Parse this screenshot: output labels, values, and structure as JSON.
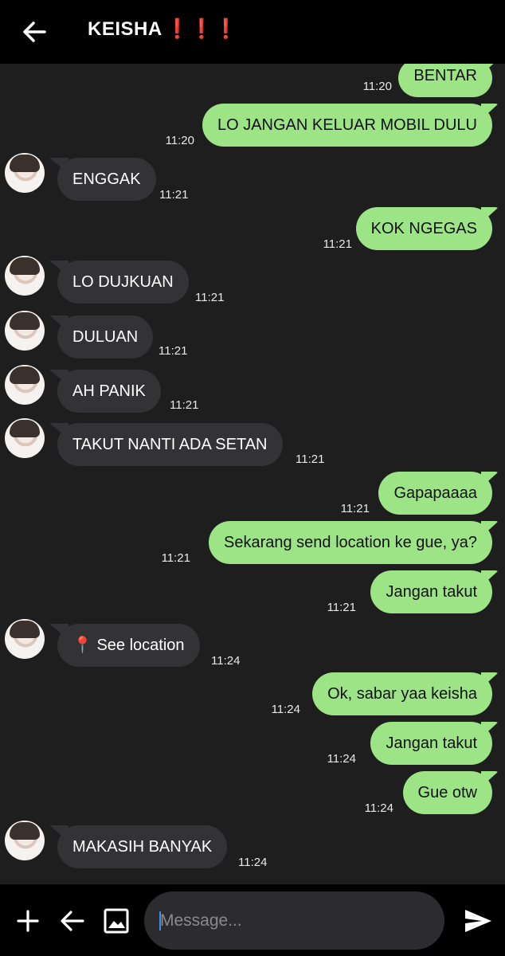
{
  "header": {
    "title": "KEISHA",
    "title_suffix": "❗❗❗",
    "back_icon": "arrow-left-icon"
  },
  "messages": [
    {
      "dir": "sent",
      "text": "BENTAR",
      "time": "11:20"
    },
    {
      "dir": "sent",
      "text": "LO JANGAN KELUAR MOBIL DULU",
      "time": "11:20"
    },
    {
      "dir": "recv",
      "text": "ENGGAK",
      "time": "11:21"
    },
    {
      "dir": "sent",
      "text": "KOK NGEGAS",
      "time": "11:21"
    },
    {
      "dir": "recv",
      "text": "LO DUJKUAN",
      "time": "11:21"
    },
    {
      "dir": "recv",
      "text": "DULUAN",
      "time": "11:21"
    },
    {
      "dir": "recv",
      "text": "AH PANIK",
      "time": "11:21"
    },
    {
      "dir": "recv",
      "text": "TAKUT NANTI ADA SETAN",
      "time": "11:21"
    },
    {
      "dir": "sent",
      "text": "Gapapaaaa",
      "time": "11:21"
    },
    {
      "dir": "sent",
      "text": "Sekarang send location ke gue, ya?",
      "time": "11:21"
    },
    {
      "dir": "sent",
      "text": "Jangan takut",
      "time": "11:21"
    },
    {
      "dir": "recv",
      "text": "📍 See location",
      "time": "11:24"
    },
    {
      "dir": "sent",
      "text": "Ok, sabar yaa keisha",
      "time": "11:24"
    },
    {
      "dir": "sent",
      "text": "Jangan takut",
      "time": "11:24"
    },
    {
      "dir": "sent",
      "text": "Gue otw",
      "time": "11:24"
    },
    {
      "dir": "recv",
      "text": "MAKASIH BANYAK",
      "time": "11:24"
    }
  ],
  "composer": {
    "placeholder": "Message...",
    "icons": [
      "plus-icon",
      "arrow-left-icon",
      "image-icon",
      "send-icon"
    ]
  },
  "colors": {
    "sent_bubble": "#9ce486",
    "recv_bubble": "#333335",
    "background": "#1e1e1e",
    "header": "#000000",
    "title_exclamation": "#e0301e"
  }
}
